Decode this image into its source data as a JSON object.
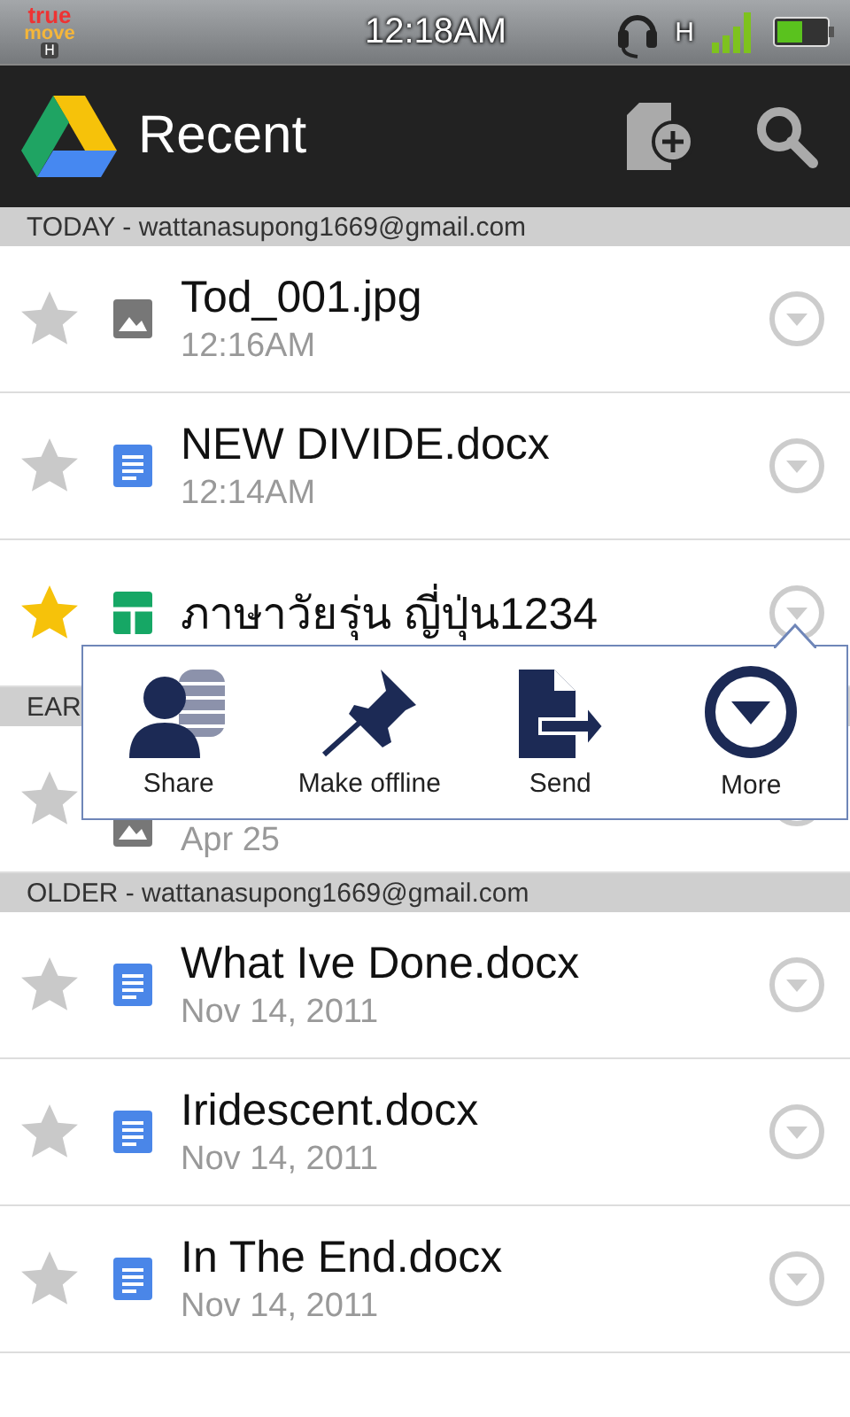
{
  "status_bar": {
    "carrier": "true",
    "carrier_line2": "move",
    "network_badge": "H",
    "time": "12:18AM",
    "data_type": "H"
  },
  "action_bar": {
    "title": "Recent"
  },
  "sections": [
    {
      "header": "TODAY - wattanasupong1669@gmail.com",
      "files": [
        {
          "name": "Tod_001.jpg",
          "time": "12:16AM",
          "starred": false,
          "kind": "image"
        },
        {
          "name": "NEW DIVIDE.docx",
          "time": "12:14AM",
          "starred": false,
          "kind": "document"
        },
        {
          "name": "ภาษาวัยรุ่น ญี่ปุ่น1234",
          "starred": true,
          "kind": "spreadsheet"
        }
      ]
    },
    {
      "header": "EAR",
      "files": [
        {
          "time": "Apr 25",
          "starred": false,
          "kind": "image"
        }
      ]
    },
    {
      "header": "OLDER - wattanasupong1669@gmail.com",
      "files": [
        {
          "name": "What Ive Done.docx",
          "time": "Nov 14, 2011",
          "starred": false,
          "kind": "document"
        },
        {
          "name": "Iridescent.docx",
          "time": "Nov 14, 2011",
          "starred": false,
          "kind": "document"
        },
        {
          "name": "In The End.docx",
          "time": "Nov 14, 2011",
          "starred": false,
          "kind": "document"
        }
      ]
    }
  ],
  "popup": {
    "actions": [
      {
        "label": "Share",
        "kind": "share"
      },
      {
        "label": "Make offline",
        "kind": "pin"
      },
      {
        "label": "Send",
        "kind": "send"
      },
      {
        "label": "More",
        "kind": "more"
      }
    ]
  }
}
